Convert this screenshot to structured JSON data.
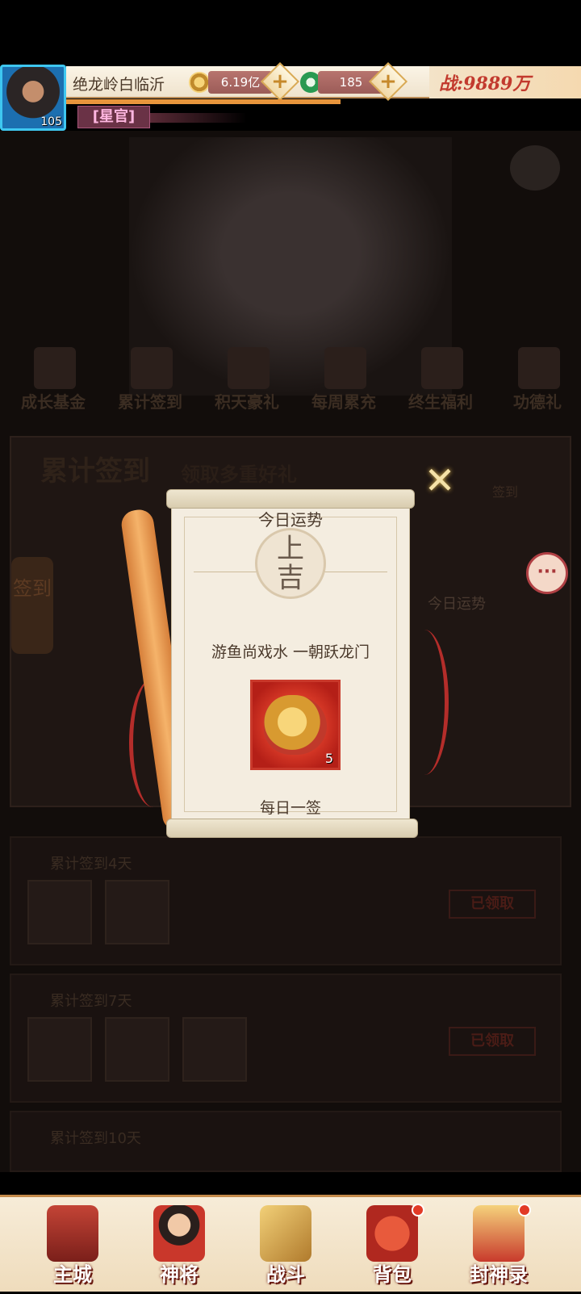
{
  "header": {
    "avatar_level": "105",
    "server_name": "绝龙岭白临沂",
    "gold_amount": "6.19亿",
    "jade_amount": "185",
    "plus_symbol": "+",
    "combat_power": "战:9889万",
    "rank_title": "[星官]"
  },
  "menu": {
    "items": [
      "成长基金",
      "累计签到",
      "积天豪礼",
      "每周累充",
      "终生福利",
      "功德礼"
    ]
  },
  "panel": {
    "title": "累计签到",
    "subtitle": "领取多重好礼",
    "sign_button": "签到",
    "side_sign_label": "签到",
    "fortune_side_label": "今日运势",
    "chat_icon": "···",
    "tasks": [
      {
        "title": "累计签到4天",
        "status": "已领取"
      },
      {
        "title": "累计签到7天",
        "status": "已领取"
      },
      {
        "title": "累计签到10天",
        "status": ""
      }
    ]
  },
  "modal": {
    "close_symbol": "✕",
    "title": "今日运势",
    "fortune": "上\n吉",
    "verse": "游鱼尚戏水  一朝跃龙门",
    "reward_count": "5",
    "daily_label": "每日一签"
  },
  "nav": {
    "items": [
      "主城",
      "神将",
      "战斗",
      "背包",
      "封神录"
    ]
  },
  "colors": {
    "accent_red": "#c9392b",
    "scroll_paper": "#f4ede0",
    "power_text": "#c23a2e"
  }
}
